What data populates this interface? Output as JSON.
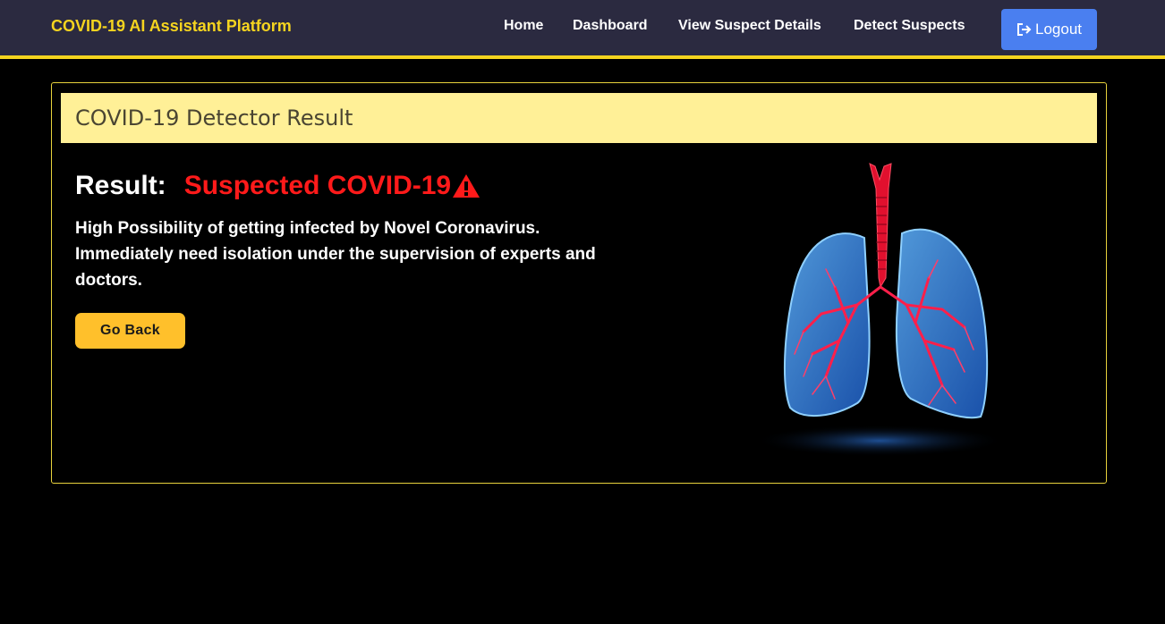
{
  "navbar": {
    "brand": "COVID-19 AI Assistant Platform",
    "links": [
      "Home",
      "Dashboard",
      "View Suspect Details",
      "Detect Suspects"
    ],
    "logout_label": "Logout",
    "logout_icon": "sign-out-icon"
  },
  "card": {
    "title": "COVID-19 Detector Result",
    "result_label": "Result:",
    "result_value": "Suspected COVID-19",
    "result_icon": "warning-triangle-icon",
    "description": "High Possibility of getting infected by Novel Coronavirus. Immediately need isolation under the supervision of experts and doctors.",
    "go_back_label": "Go Back",
    "illustration": "lungs-illustration"
  },
  "colors": {
    "navbar_bg": "#2b2a40",
    "accent_yellow": "#f5d41f",
    "header_bg": "#fff097",
    "result_red": "#ff1a1a",
    "logout_blue": "#4a7ff0",
    "button_yellow": "#ffc02b"
  }
}
